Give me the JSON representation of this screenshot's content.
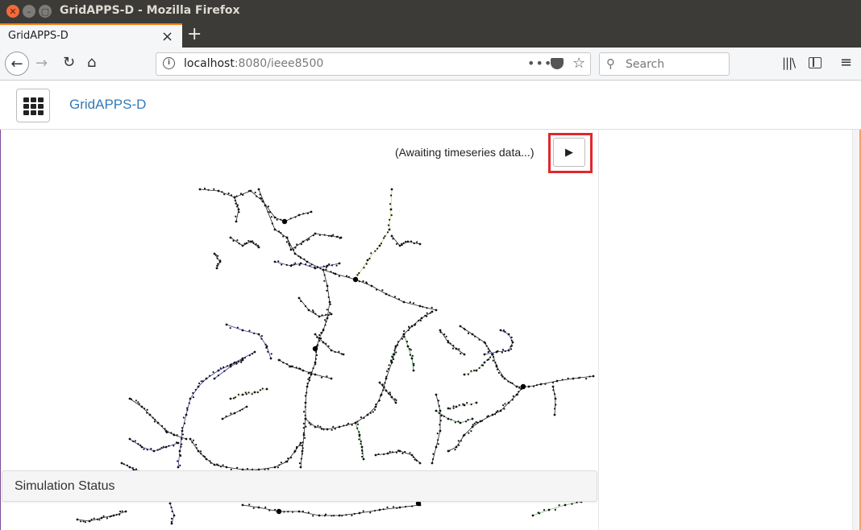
{
  "window": {
    "title": "GridAPPS-D - Mozilla Firefox"
  },
  "browser": {
    "tab_title": "GridAPPS-D",
    "url_host": "localhost",
    "url_rest": ":8080/ieee8500",
    "search_placeholder": "Search",
    "url_actions_glyph": "•••"
  },
  "app": {
    "title": "GridAPPS-D",
    "status_text": "(Awaiting timeseries data...)",
    "play_glyph": "▶",
    "simulation_status_title": "Simulation Status"
  },
  "colors": {
    "link": "#337ab7",
    "highlight": "#e0282c",
    "tab_accent": "#f57f17"
  }
}
